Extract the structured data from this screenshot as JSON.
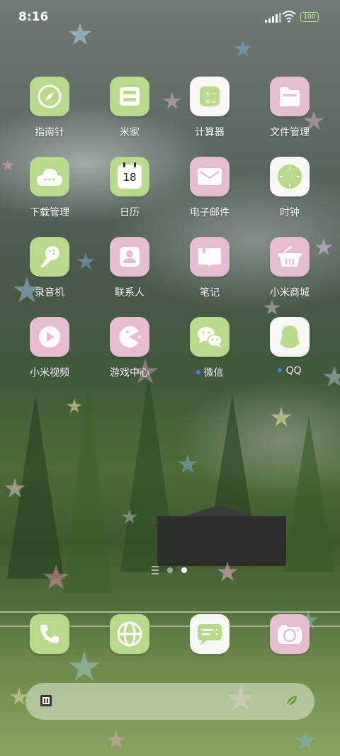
{
  "status_bar": {
    "time": "8:16",
    "battery": "100"
  },
  "apps": [
    {
      "id": "compass",
      "label": "指南针",
      "icon": "compass-icon",
      "style": "green"
    },
    {
      "id": "mijia",
      "label": "米家",
      "icon": "mijia-icon",
      "style": "green"
    },
    {
      "id": "calculator",
      "label": "计算器",
      "icon": "calculator-icon",
      "style": "white"
    },
    {
      "id": "files",
      "label": "文件管理",
      "icon": "folder-icon",
      "style": "pink"
    },
    {
      "id": "downloads",
      "label": "下载管理",
      "icon": "cloud-download-icon",
      "style": "green"
    },
    {
      "id": "calendar",
      "label": "日历",
      "icon": "calendar-icon",
      "style": "green",
      "badge": "18"
    },
    {
      "id": "email",
      "label": "电子邮件",
      "icon": "envelope-icon",
      "style": "pink"
    },
    {
      "id": "clock",
      "label": "时钟",
      "icon": "clock-icon",
      "style": "white"
    },
    {
      "id": "recorder",
      "label": "录音机",
      "icon": "microphone-icon",
      "style": "green"
    },
    {
      "id": "contacts",
      "label": "联系人",
      "icon": "contact-icon",
      "style": "pink"
    },
    {
      "id": "notes",
      "label": "笔记",
      "icon": "notebook-icon",
      "style": "pink"
    },
    {
      "id": "mi-store",
      "label": "小米商城",
      "icon": "basket-icon",
      "style": "pink"
    },
    {
      "id": "mi-video",
      "label": "小米视频",
      "icon": "play-icon",
      "style": "pink"
    },
    {
      "id": "game-center",
      "label": "游戏中心",
      "icon": "pacman-icon",
      "style": "pink"
    },
    {
      "id": "wechat",
      "label": "微信",
      "icon": "wechat-icon",
      "style": "green",
      "new": true
    },
    {
      "id": "qq",
      "label": "QQ",
      "icon": "penguin-icon",
      "style": "white",
      "new": true
    }
  ],
  "dock": [
    {
      "id": "phone",
      "icon": "phone-icon",
      "style": "green"
    },
    {
      "id": "browser",
      "icon": "globe-icon",
      "style": "green"
    },
    {
      "id": "messages",
      "icon": "message-icon",
      "style": "white"
    },
    {
      "id": "camera",
      "icon": "camera-icon",
      "style": "pink"
    }
  ],
  "page_indicator": {
    "pages": 2,
    "current": 2
  },
  "colors": {
    "green_tile": "#b9d98a",
    "pink_tile": "#e8bcd0",
    "white_tile": "#f7f7f5",
    "notification_dot": "#3d7bf5"
  }
}
